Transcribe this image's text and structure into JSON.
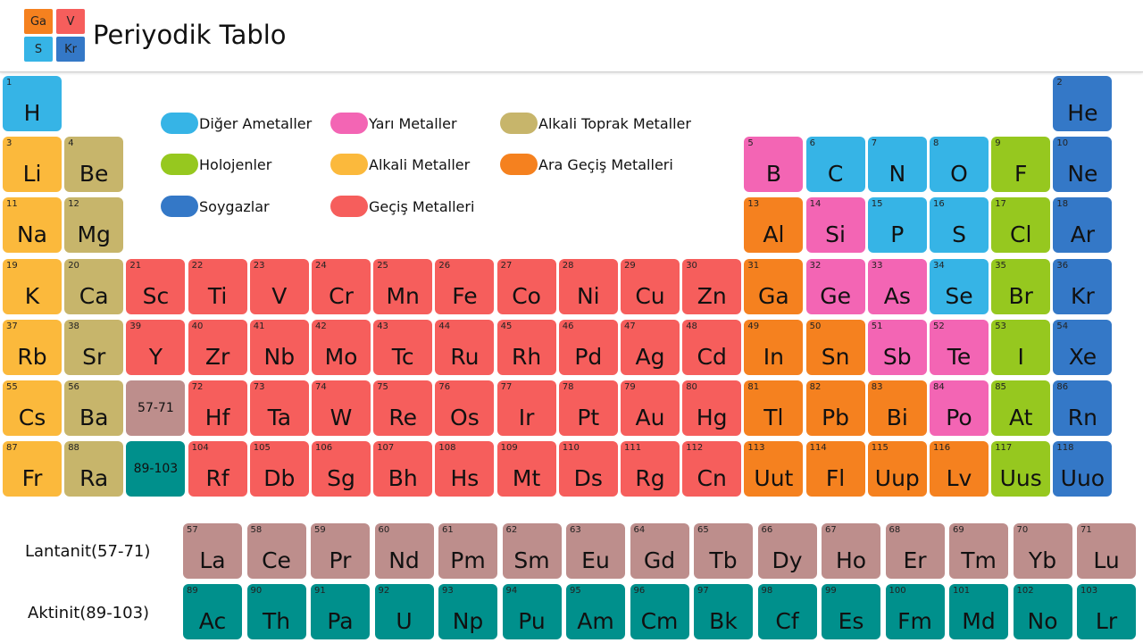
{
  "app": {
    "title": "Periyodik Tablo",
    "logo_cells": [
      {
        "text": "Ga",
        "color": "#f5811f"
      },
      {
        "text": "V",
        "color": "#f65e5c"
      },
      {
        "text": "S",
        "color": "#36b4e6"
      },
      {
        "text": "Kr",
        "color": "#3478c7"
      }
    ]
  },
  "colors": {
    "diger": "#36b4e6",
    "yari": "#f365b4",
    "alkalitoprak": "#c7b56b",
    "holojen": "#96c81f",
    "alkali": "#fbb93c",
    "aragecis": "#f5811f",
    "soygaz": "#3478c7",
    "gecis": "#f65e5c",
    "lantanit": "#bd8e8c",
    "aktinit": "#00908c"
  },
  "legend": [
    {
      "label": "Diğer Ametaller",
      "cat": "diger"
    },
    {
      "label": "Yarı Metaller",
      "cat": "yari"
    },
    {
      "label": "Alkali Toprak Metaller",
      "cat": "alkalitoprak"
    },
    {
      "label": "Holojenler",
      "cat": "holojen"
    },
    {
      "label": "Alkali Metaller",
      "cat": "alkali"
    },
    {
      "label": "Ara Geçiş Metalleri",
      "cat": "aragecis"
    },
    {
      "label": "Soygazlar",
      "cat": "soygaz"
    },
    {
      "label": "Geçiş Metalleri",
      "cat": "gecis"
    }
  ],
  "row_labels": {
    "lantanit": "Lantanit(57-71)",
    "aktinit": "Aktinit(89-103)"
  },
  "placeholders": [
    {
      "text": "57-71",
      "cat": "lantanit"
    },
    {
      "text": "89-103",
      "cat": "aktinit"
    }
  ],
  "elements": [
    {
      "n": 1,
      "s": "H",
      "cat": "diger",
      "row": 1,
      "col": 1
    },
    {
      "n": 2,
      "s": "He",
      "cat": "soygaz",
      "row": 1,
      "col": 18
    },
    {
      "n": 3,
      "s": "Li",
      "cat": "alkali",
      "row": 2,
      "col": 1
    },
    {
      "n": 4,
      "s": "Be",
      "cat": "alkalitoprak",
      "row": 2,
      "col": 2
    },
    {
      "n": 5,
      "s": "B",
      "cat": "yari",
      "row": 2,
      "col": 13
    },
    {
      "n": 6,
      "s": "C",
      "cat": "diger",
      "row": 2,
      "col": 14
    },
    {
      "n": 7,
      "s": "N",
      "cat": "diger",
      "row": 2,
      "col": 15
    },
    {
      "n": 8,
      "s": "O",
      "cat": "diger",
      "row": 2,
      "col": 16
    },
    {
      "n": 9,
      "s": "F",
      "cat": "holojen",
      "row": 2,
      "col": 17
    },
    {
      "n": 10,
      "s": "Ne",
      "cat": "soygaz",
      "row": 2,
      "col": 18
    },
    {
      "n": 11,
      "s": "Na",
      "cat": "alkali",
      "row": 3,
      "col": 1
    },
    {
      "n": 12,
      "s": "Mg",
      "cat": "alkalitoprak",
      "row": 3,
      "col": 2
    },
    {
      "n": 13,
      "s": "Al",
      "cat": "aragecis",
      "row": 3,
      "col": 13
    },
    {
      "n": 14,
      "s": "Si",
      "cat": "yari",
      "row": 3,
      "col": 14
    },
    {
      "n": 15,
      "s": "P",
      "cat": "diger",
      "row": 3,
      "col": 15
    },
    {
      "n": 16,
      "s": "S",
      "cat": "diger",
      "row": 3,
      "col": 16
    },
    {
      "n": 17,
      "s": "Cl",
      "cat": "holojen",
      "row": 3,
      "col": 17
    },
    {
      "n": 18,
      "s": "Ar",
      "cat": "soygaz",
      "row": 3,
      "col": 18
    },
    {
      "n": 19,
      "s": "K",
      "cat": "alkali",
      "row": 4,
      "col": 1
    },
    {
      "n": 20,
      "s": "Ca",
      "cat": "alkalitoprak",
      "row": 4,
      "col": 2
    },
    {
      "n": 21,
      "s": "Sc",
      "cat": "gecis",
      "row": 4,
      "col": 3
    },
    {
      "n": 22,
      "s": "Ti",
      "cat": "gecis",
      "row": 4,
      "col": 4
    },
    {
      "n": 23,
      "s": "V",
      "cat": "gecis",
      "row": 4,
      "col": 5
    },
    {
      "n": 24,
      "s": "Cr",
      "cat": "gecis",
      "row": 4,
      "col": 6
    },
    {
      "n": 25,
      "s": "Mn",
      "cat": "gecis",
      "row": 4,
      "col": 7
    },
    {
      "n": 26,
      "s": "Fe",
      "cat": "gecis",
      "row": 4,
      "col": 8
    },
    {
      "n": 27,
      "s": "Co",
      "cat": "gecis",
      "row": 4,
      "col": 9
    },
    {
      "n": 28,
      "s": "Ni",
      "cat": "gecis",
      "row": 4,
      "col": 10
    },
    {
      "n": 29,
      "s": "Cu",
      "cat": "gecis",
      "row": 4,
      "col": 11
    },
    {
      "n": 30,
      "s": "Zn",
      "cat": "gecis",
      "row": 4,
      "col": 12
    },
    {
      "n": 31,
      "s": "Ga",
      "cat": "aragecis",
      "row": 4,
      "col": 13
    },
    {
      "n": 32,
      "s": "Ge",
      "cat": "yari",
      "row": 4,
      "col": 14
    },
    {
      "n": 33,
      "s": "As",
      "cat": "yari",
      "row": 4,
      "col": 15
    },
    {
      "n": 34,
      "s": "Se",
      "cat": "diger",
      "row": 4,
      "col": 16
    },
    {
      "n": 35,
      "s": "Br",
      "cat": "holojen",
      "row": 4,
      "col": 17
    },
    {
      "n": 36,
      "s": "Kr",
      "cat": "soygaz",
      "row": 4,
      "col": 18
    },
    {
      "n": 37,
      "s": "Rb",
      "cat": "alkali",
      "row": 5,
      "col": 1
    },
    {
      "n": 38,
      "s": "Sr",
      "cat": "alkalitoprak",
      "row": 5,
      "col": 2
    },
    {
      "n": 39,
      "s": "Y",
      "cat": "gecis",
      "row": 5,
      "col": 3
    },
    {
      "n": 40,
      "s": "Zr",
      "cat": "gecis",
      "row": 5,
      "col": 4
    },
    {
      "n": 41,
      "s": "Nb",
      "cat": "gecis",
      "row": 5,
      "col": 5
    },
    {
      "n": 42,
      "s": "Mo",
      "cat": "gecis",
      "row": 5,
      "col": 6
    },
    {
      "n": 43,
      "s": "Tc",
      "cat": "gecis",
      "row": 5,
      "col": 7
    },
    {
      "n": 44,
      "s": "Ru",
      "cat": "gecis",
      "row": 5,
      "col": 8
    },
    {
      "n": 45,
      "s": "Rh",
      "cat": "gecis",
      "row": 5,
      "col": 9
    },
    {
      "n": 46,
      "s": "Pd",
      "cat": "gecis",
      "row": 5,
      "col": 10
    },
    {
      "n": 47,
      "s": "Ag",
      "cat": "gecis",
      "row": 5,
      "col": 11
    },
    {
      "n": 48,
      "s": "Cd",
      "cat": "gecis",
      "row": 5,
      "col": 12
    },
    {
      "n": 49,
      "s": "In",
      "cat": "aragecis",
      "row": 5,
      "col": 13
    },
    {
      "n": 50,
      "s": "Sn",
      "cat": "aragecis",
      "row": 5,
      "col": 14
    },
    {
      "n": 51,
      "s": "Sb",
      "cat": "yari",
      "row": 5,
      "col": 15
    },
    {
      "n": 52,
      "s": "Te",
      "cat": "yari",
      "row": 5,
      "col": 16
    },
    {
      "n": 53,
      "s": "I",
      "cat": "holojen",
      "row": 5,
      "col": 17
    },
    {
      "n": 54,
      "s": "Xe",
      "cat": "soygaz",
      "row": 5,
      "col": 18
    },
    {
      "n": 55,
      "s": "Cs",
      "cat": "alkali",
      "row": 6,
      "col": 1
    },
    {
      "n": 56,
      "s": "Ba",
      "cat": "alkalitoprak",
      "row": 6,
      "col": 2
    },
    {
      "n": 72,
      "s": "Hf",
      "cat": "gecis",
      "row": 6,
      "col": 4
    },
    {
      "n": 73,
      "s": "Ta",
      "cat": "gecis",
      "row": 6,
      "col": 5
    },
    {
      "n": 74,
      "s": "W",
      "cat": "gecis",
      "row": 6,
      "col": 6
    },
    {
      "n": 75,
      "s": "Re",
      "cat": "gecis",
      "row": 6,
      "col": 7
    },
    {
      "n": 76,
      "s": "Os",
      "cat": "gecis",
      "row": 6,
      "col": 8
    },
    {
      "n": 77,
      "s": "Ir",
      "cat": "gecis",
      "row": 6,
      "col": 9
    },
    {
      "n": 78,
      "s": "Pt",
      "cat": "gecis",
      "row": 6,
      "col": 10
    },
    {
      "n": 79,
      "s": "Au",
      "cat": "gecis",
      "row": 6,
      "col": 11
    },
    {
      "n": 80,
      "s": "Hg",
      "cat": "gecis",
      "row": 6,
      "col": 12
    },
    {
      "n": 81,
      "s": "Tl",
      "cat": "aragecis",
      "row": 6,
      "col": 13
    },
    {
      "n": 82,
      "s": "Pb",
      "cat": "aragecis",
      "row": 6,
      "col": 14
    },
    {
      "n": 83,
      "s": "Bi",
      "cat": "aragecis",
      "row": 6,
      "col": 15
    },
    {
      "n": 84,
      "s": "Po",
      "cat": "yari",
      "row": 6,
      "col": 16
    },
    {
      "n": 85,
      "s": "At",
      "cat": "holojen",
      "row": 6,
      "col": 17
    },
    {
      "n": 86,
      "s": "Rn",
      "cat": "soygaz",
      "row": 6,
      "col": 18
    },
    {
      "n": 87,
      "s": "Fr",
      "cat": "alkali",
      "row": 7,
      "col": 1
    },
    {
      "n": 88,
      "s": "Ra",
      "cat": "alkalitoprak",
      "row": 7,
      "col": 2
    },
    {
      "n": 104,
      "s": "Rf",
      "cat": "gecis",
      "row": 7,
      "col": 4
    },
    {
      "n": 105,
      "s": "Db",
      "cat": "gecis",
      "row": 7,
      "col": 5
    },
    {
      "n": 106,
      "s": "Sg",
      "cat": "gecis",
      "row": 7,
      "col": 6
    },
    {
      "n": 107,
      "s": "Bh",
      "cat": "gecis",
      "row": 7,
      "col": 7
    },
    {
      "n": 108,
      "s": "Hs",
      "cat": "gecis",
      "row": 7,
      "col": 8
    },
    {
      "n": 109,
      "s": "Mt",
      "cat": "gecis",
      "row": 7,
      "col": 9
    },
    {
      "n": 110,
      "s": "Ds",
      "cat": "gecis",
      "row": 7,
      "col": 10
    },
    {
      "n": 111,
      "s": "Rg",
      "cat": "gecis",
      "row": 7,
      "col": 11
    },
    {
      "n": 112,
      "s": "Cn",
      "cat": "gecis",
      "row": 7,
      "col": 12
    },
    {
      "n": 113,
      "s": "Uut",
      "cat": "aragecis",
      "row": 7,
      "col": 13
    },
    {
      "n": 114,
      "s": "Fl",
      "cat": "aragecis",
      "row": 7,
      "col": 14
    },
    {
      "n": 115,
      "s": "Uup",
      "cat": "aragecis",
      "row": 7,
      "col": 15
    },
    {
      "n": 116,
      "s": "Lv",
      "cat": "aragecis",
      "row": 7,
      "col": 16
    },
    {
      "n": 117,
      "s": "Uus",
      "cat": "holojen",
      "row": 7,
      "col": 17
    },
    {
      "n": 118,
      "s": "Uuo",
      "cat": "soygaz",
      "row": 7,
      "col": 18
    },
    {
      "n": 57,
      "s": "La",
      "cat": "lantanit",
      "row": 9,
      "col": 1
    },
    {
      "n": 58,
      "s": "Ce",
      "cat": "lantanit",
      "row": 9,
      "col": 2
    },
    {
      "n": 59,
      "s": "Pr",
      "cat": "lantanit",
      "row": 9,
      "col": 3
    },
    {
      "n": 60,
      "s": "Nd",
      "cat": "lantanit",
      "row": 9,
      "col": 4
    },
    {
      "n": 61,
      "s": "Pm",
      "cat": "lantanit",
      "row": 9,
      "col": 5
    },
    {
      "n": 62,
      "s": "Sm",
      "cat": "lantanit",
      "row": 9,
      "col": 6
    },
    {
      "n": 63,
      "s": "Eu",
      "cat": "lantanit",
      "row": 9,
      "col": 7
    },
    {
      "n": 64,
      "s": "Gd",
      "cat": "lantanit",
      "row": 9,
      "col": 8
    },
    {
      "n": 65,
      "s": "Tb",
      "cat": "lantanit",
      "row": 9,
      "col": 9
    },
    {
      "n": 66,
      "s": "Dy",
      "cat": "lantanit",
      "row": 9,
      "col": 10
    },
    {
      "n": 67,
      "s": "Ho",
      "cat": "lantanit",
      "row": 9,
      "col": 11
    },
    {
      "n": 68,
      "s": "Er",
      "cat": "lantanit",
      "row": 9,
      "col": 12
    },
    {
      "n": 69,
      "s": "Tm",
      "cat": "lantanit",
      "row": 9,
      "col": 13
    },
    {
      "n": 70,
      "s": "Yb",
      "cat": "lantanit",
      "row": 9,
      "col": 14
    },
    {
      "n": 71,
      "s": "Lu",
      "cat": "lantanit",
      "row": 9,
      "col": 15
    },
    {
      "n": 89,
      "s": "Ac",
      "cat": "aktinit",
      "row": 10,
      "col": 1
    },
    {
      "n": 90,
      "s": "Th",
      "cat": "aktinit",
      "row": 10,
      "col": 2
    },
    {
      "n": 91,
      "s": "Pa",
      "cat": "aktinit",
      "row": 10,
      "col": 3
    },
    {
      "n": 92,
      "s": "U",
      "cat": "aktinit",
      "row": 10,
      "col": 4
    },
    {
      "n": 93,
      "s": "Np",
      "cat": "aktinit",
      "row": 10,
      "col": 5
    },
    {
      "n": 94,
      "s": "Pu",
      "cat": "aktinit",
      "row": 10,
      "col": 6
    },
    {
      "n": 95,
      "s": "Am",
      "cat": "aktinit",
      "row": 10,
      "col": 7
    },
    {
      "n": 96,
      "s": "Cm",
      "cat": "aktinit",
      "row": 10,
      "col": 8
    },
    {
      "n": 97,
      "s": "Bk",
      "cat": "aktinit",
      "row": 10,
      "col": 9
    },
    {
      "n": 98,
      "s": "Cf",
      "cat": "aktinit",
      "row": 10,
      "col": 10
    },
    {
      "n": 99,
      "s": "Es",
      "cat": "aktinit",
      "row": 10,
      "col": 11
    },
    {
      "n": 100,
      "s": "Fm",
      "cat": "aktinit",
      "row": 10,
      "col": 12
    },
    {
      "n": 101,
      "s": "Md",
      "cat": "aktinit",
      "row": 10,
      "col": 13
    },
    {
      "n": 102,
      "s": "No",
      "cat": "aktinit",
      "row": 10,
      "col": 14
    },
    {
      "n": 103,
      "s": "Lr",
      "cat": "aktinit",
      "row": 10,
      "col": 15
    }
  ]
}
